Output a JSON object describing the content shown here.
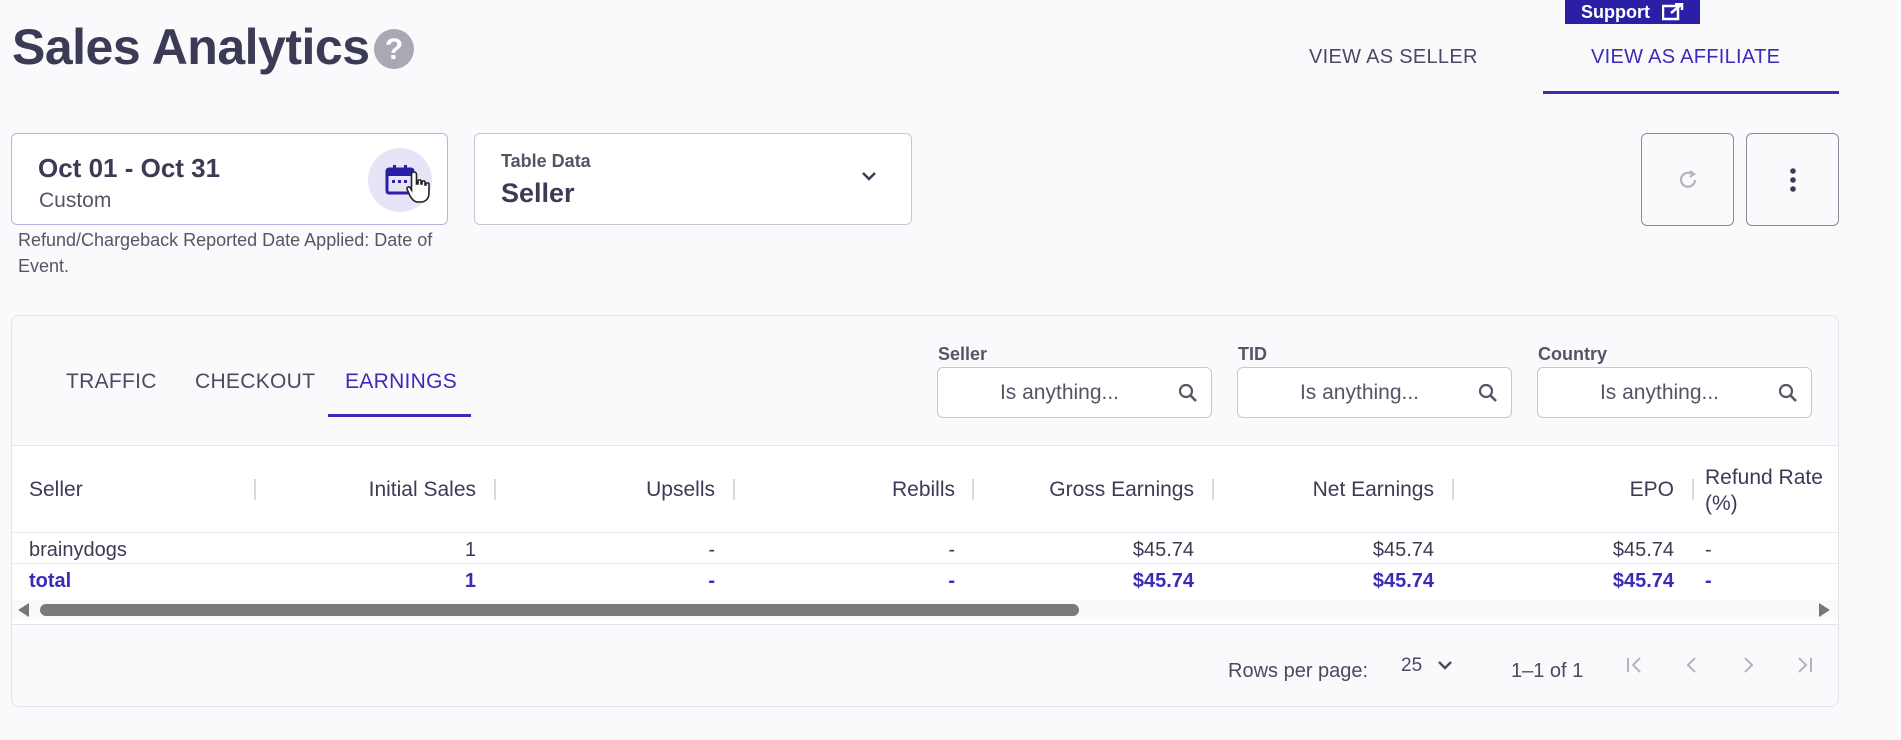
{
  "header": {
    "title": "Sales Analytics",
    "help_icon": "?",
    "support_label": "Support",
    "view_as_seller": "VIEW AS SELLER",
    "view_as_affiliate": "VIEW AS AFFILIATE",
    "active_view": "VIEW AS AFFILIATE"
  },
  "date_picker": {
    "range": "Oct 01 - Oct 31",
    "mode": "Custom",
    "note": "Refund/Chargeback Reported Date Applied: Date of Event.",
    "icon": "calendar-icon"
  },
  "table_data_select": {
    "label": "Table Data",
    "value": "Seller"
  },
  "toolbar": {
    "refresh_icon": "refresh-icon",
    "more_icon": "more-vertical-icon"
  },
  "tabs": {
    "items": [
      "TRAFFIC",
      "CHECKOUT",
      "EARNINGS"
    ],
    "active": "EARNINGS"
  },
  "filters": [
    {
      "label": "Seller",
      "placeholder": "Is anything..."
    },
    {
      "label": "TID",
      "placeholder": "Is anything..."
    },
    {
      "label": "Country",
      "placeholder": "Is anything..."
    }
  ],
  "table": {
    "columns": [
      "Seller",
      "Initial Sales",
      "Upsells",
      "Rebills",
      "Gross Earnings",
      "Net Earnings",
      "EPO",
      "Refund Rate",
      "(%)"
    ],
    "rows": [
      [
        "brainydogs",
        "1",
        "-",
        "-",
        "$45.74",
        "$45.74",
        "$45.74",
        "-"
      ]
    ],
    "total": [
      "total",
      "1",
      "-",
      "-",
      "$45.74",
      "$45.74",
      "$45.74",
      "-"
    ]
  },
  "pagination": {
    "rows_per_page_label": "Rows per page:",
    "rows_per_page": "25",
    "range": "1–1 of 1"
  },
  "colors": {
    "accent": "#3a2bb8",
    "support_bg": "#2b1fa6",
    "text": "#3b3b55"
  }
}
